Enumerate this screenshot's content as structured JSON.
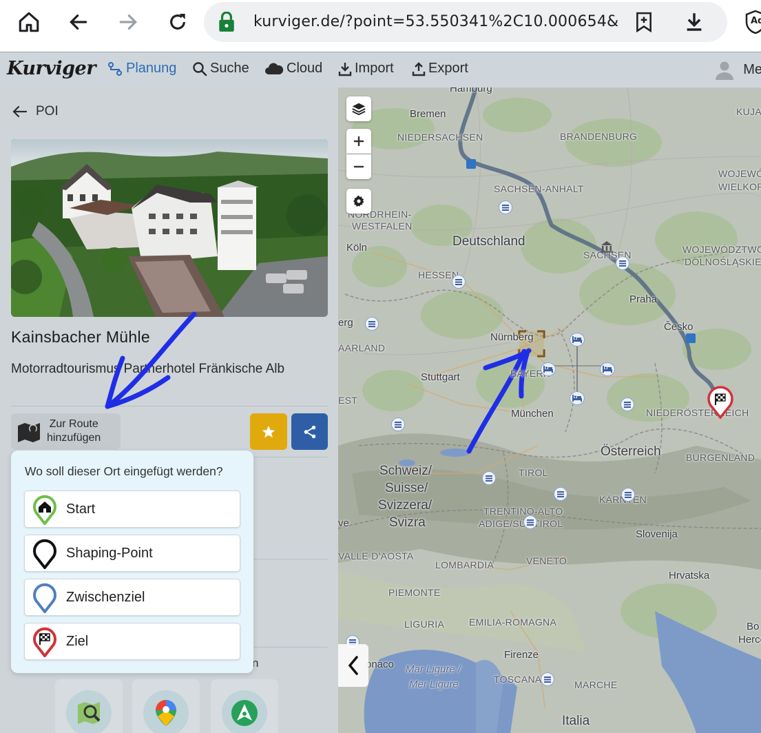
{
  "browser": {
    "url": "kurviger.de/?point=53.550341%2C10.000654&",
    "icons": [
      "home-icon",
      "back-icon",
      "forward-icon",
      "reload-icon",
      "lock-icon",
      "bookmark-add-icon",
      "download-icon",
      "adblock-icon"
    ],
    "adblock_label": "Ad"
  },
  "header": {
    "logo": "Kurviger",
    "nav": [
      {
        "label": "Planung",
        "icon": "route-icon",
        "active": true
      },
      {
        "label": "Suche",
        "icon": "search-icon"
      },
      {
        "label": "Cloud",
        "icon": "cloud-icon"
      },
      {
        "label": "Import",
        "icon": "import-icon"
      },
      {
        "label": "Export",
        "icon": "export-icon"
      }
    ],
    "user_label": "Me"
  },
  "panel": {
    "back_label": "POI",
    "title": "Kainsbacher Mühle",
    "subtitle": "Motorradtourismus Partnerhotel Fränkische Alb",
    "add_route_label_1": "Zur Route",
    "add_route_label_2": "hinzufügen",
    "hidden_text": "n"
  },
  "popup": {
    "question": "Wo soll dieser Ort eingefügt werden?",
    "options": [
      {
        "label": "Start",
        "color": "#6fbe4a"
      },
      {
        "label": "Shaping-Point",
        "color": "#111111"
      },
      {
        "label": "Zwischenziel",
        "color": "#4f7fc0"
      },
      {
        "label": "Ziel",
        "color": "#d0333a"
      }
    ]
  },
  "map": {
    "labels": {
      "bremen": "Bremen",
      "niedersachsen": "NIEDERSACHSEN",
      "brandenburg": "BRANDENBURG",
      "kujaw": "KUJAW",
      "wojew": "WOJEWÓ",
      "wielkop": "WIELKOP",
      "sachsen_anhalt": "SACHSEN-ANHALT",
      "nrw1": "NORDRHEIN-",
      "nrw2": "WESTFALEN",
      "koln": "Köln",
      "deutschland": "Deutschland",
      "sachsen": "SACHSEN",
      "woj_dolno1": "WOJEWÓDZTWO",
      "woj_dolno2": "DOLNOŚLĄSKIE",
      "hessen": "HESSEN",
      "praha": "Praha",
      "erg": "erg",
      "cesko": "Česko",
      "nurnberg": "Nürnberg",
      "saarland": "AARLAND",
      "bayern": "BAYERN",
      "stuttgart": "Stuttgart",
      "est": "EST",
      "munchen": "München",
      "niederosterreich": "NIEDERÖSTERREICH",
      "osterreich": "Österreich",
      "burgenland": "BURGENLAND",
      "schweiz1": "Schweiz/",
      "schweiz2": "Suisse/",
      "schweiz3": "Svizzera/",
      "schweiz4": "Svizra",
      "tirol": "TIROL",
      "karnten": "KÄRNTEN",
      "trentino1": "TRENTINO-ALTO",
      "trentino2": "ADIGE/SÜDTIROL",
      "slovenija": "Slovenija",
      "ve": "ve",
      "aosta": "VALLE D'AOSTA",
      "lombardia": "LOMBARDIA",
      "veneto": "VENETO",
      "hrvatska": "Hrvatska",
      "piemonte": "PIEMONTE",
      "liguria": "LIGURIA",
      "emilia": "EMILIA-ROMAGNA",
      "bo1": "Bo",
      "bo2": "Herce",
      "monaco": "onaco",
      "mar1": "Mar Ligure /",
      "mar2": "Mer Ligure",
      "firenze": "Firenze",
      "toscana": "TOSCANA",
      "marche": "MARCHE",
      "italia": "Italia",
      "hamburg": "Hamburg"
    },
    "controls": [
      "layers-icon",
      "zoom-in-icon",
      "zoom-out-icon",
      "settings-icon"
    ],
    "colors": {
      "route": "#5a6e86",
      "target": "#d0333a",
      "annotation": "#1f2ee6"
    }
  }
}
